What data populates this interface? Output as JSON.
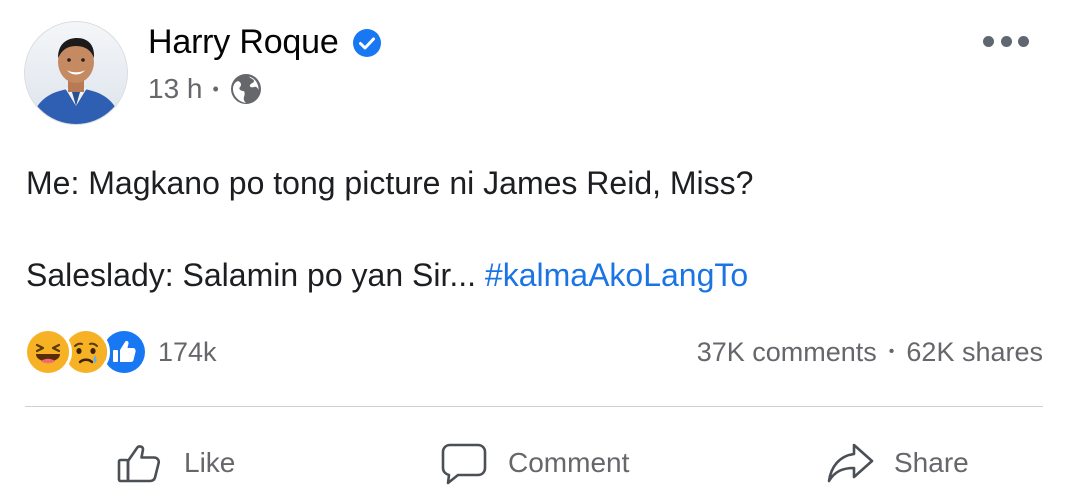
{
  "post": {
    "author": {
      "name": "Harry Roque",
      "verified": true,
      "avatar_icon": "profile-photo"
    },
    "timestamp": "13 h",
    "separator": "•",
    "audience_icon": "globe-icon",
    "more_icon": "more-options-icon",
    "text": {
      "line1": "Me: Magkano po tong picture ni James Reid, Miss?",
      "line2_prefix": "Saleslady: Salamin po yan Sir... ",
      "hashtag": "#kalmaAkoLangTo"
    }
  },
  "engagement": {
    "reactions": [
      "haha",
      "sad",
      "like"
    ],
    "reaction_count": "174k",
    "comments": "37K comments",
    "separator": "•",
    "shares": "62K shares"
  },
  "actions": {
    "like": "Like",
    "comment": "Comment",
    "share": "Share"
  },
  "colors": {
    "link_blue": "#1b74e4",
    "verified_blue": "#1877f2",
    "secondary_text": "#65676b",
    "divider": "#ced0d4"
  }
}
